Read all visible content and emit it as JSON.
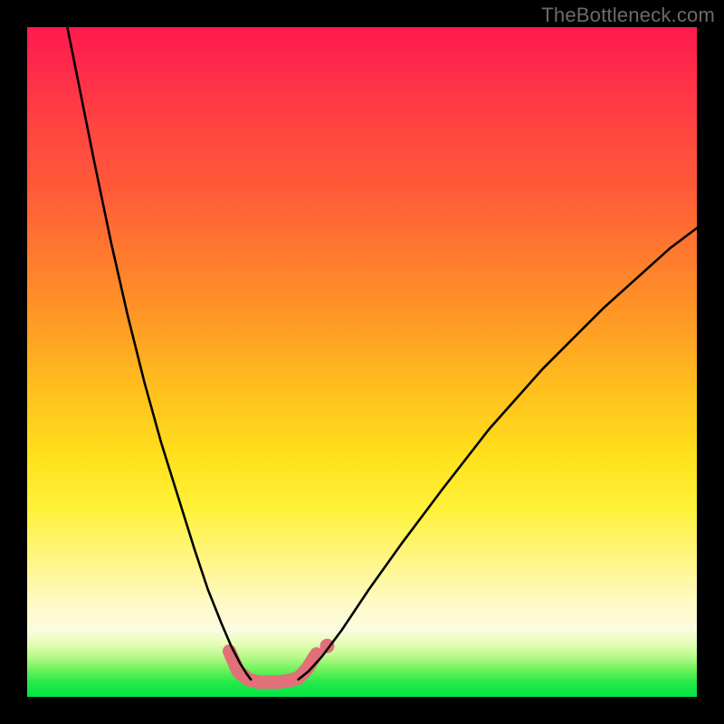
{
  "watermark": "TheBottleneck.com",
  "chart_data": {
    "type": "line",
    "title": "",
    "xlabel": "",
    "ylabel": "",
    "xlim": [
      0,
      100
    ],
    "ylim": [
      0,
      100
    ],
    "grid": false,
    "legend": false,
    "gradient_stops": [
      {
        "pos": 0,
        "color": "#ff1a4f"
      },
      {
        "pos": 14,
        "color": "#ff4242"
      },
      {
        "pos": 34,
        "color": "#ff7a2e"
      },
      {
        "pos": 54,
        "color": "#ffbf1e"
      },
      {
        "pos": 72,
        "color": "#fff23a"
      },
      {
        "pos": 86,
        "color": "#fffac6"
      },
      {
        "pos": 94,
        "color": "#b8fa8a"
      },
      {
        "pos": 100,
        "color": "#00e646"
      }
    ],
    "series": [
      {
        "name": "left-branch",
        "color": "#000000",
        "width": 2.6,
        "x": [
          6.0,
          8.0,
          10.0,
          12.5,
          15.0,
          17.5,
          20.0,
          22.5,
          25.0,
          27.0,
          29.0,
          30.5,
          31.8,
          32.8,
          33.4
        ],
        "y": [
          100,
          90,
          80,
          68,
          57,
          47,
          38,
          30,
          22,
          16,
          11,
          7.5,
          5.0,
          3.4,
          2.6
        ]
      },
      {
        "name": "right-branch",
        "color": "#000000",
        "width": 2.6,
        "x": [
          40.5,
          42.0,
          44.0,
          47.0,
          51.0,
          56.0,
          62.0,
          69.0,
          77.0,
          86.0,
          96.0,
          100.0
        ],
        "y": [
          2.6,
          3.8,
          6.0,
          10.0,
          16.0,
          23.0,
          31.0,
          40.0,
          49.0,
          58.0,
          67.0,
          70.0
        ]
      },
      {
        "name": "well-highlight",
        "color": "#e17079",
        "width": 15,
        "linecap": "round",
        "x": [
          30.2,
          31.5,
          33.0,
          34.5,
          36.0,
          37.5,
          39.0,
          40.5,
          41.8,
          43.2
        ],
        "y": [
          6.8,
          3.8,
          2.6,
          2.2,
          2.2,
          2.2,
          2.4,
          2.8,
          4.2,
          6.4
        ]
      }
    ],
    "well_highlight_dots": [
      {
        "x": 43.2,
        "y": 6.4
      }
    ],
    "annotations": []
  }
}
